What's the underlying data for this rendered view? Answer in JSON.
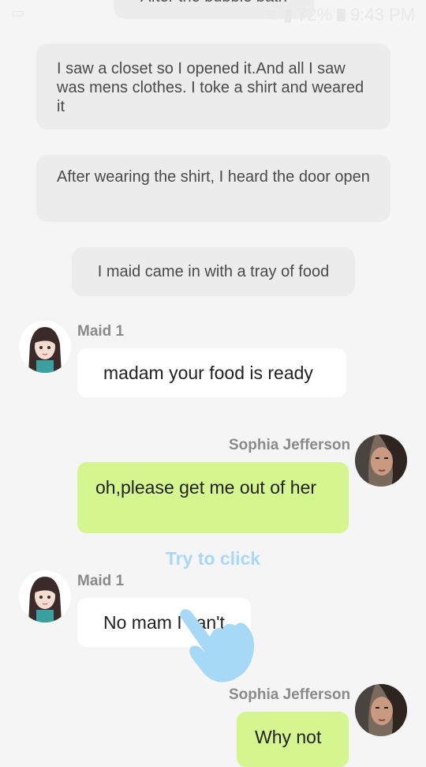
{
  "status": {
    "battery": "72%",
    "time": "9:43 PM"
  },
  "narrations": {
    "top_partial": "After the bubble bath",
    "n1": "I saw a closet so I opened it.And all I saw was mens clothes. I toke a shirt and weared it",
    "n2": "After wearing the shirt, I heard the door open",
    "n3": "I maid came in with a tray of food"
  },
  "messages": [
    {
      "sender": "Maid 1",
      "text": "madam your food is ready"
    },
    {
      "sender": "Sophia Jefferson",
      "text": "oh,please get me out of her"
    },
    {
      "sender": "Maid 1",
      "text": "No mam I can't"
    },
    {
      "sender": "Sophia Jefferson",
      "text": "Why not"
    }
  ],
  "hint": "Try to click",
  "colors": {
    "background": "#f5f5f5",
    "narration_bubble": "#ececec",
    "left_bubble": "#ffffff",
    "right_bubble": "#d5f58f",
    "hint": "#a8d8f4"
  }
}
